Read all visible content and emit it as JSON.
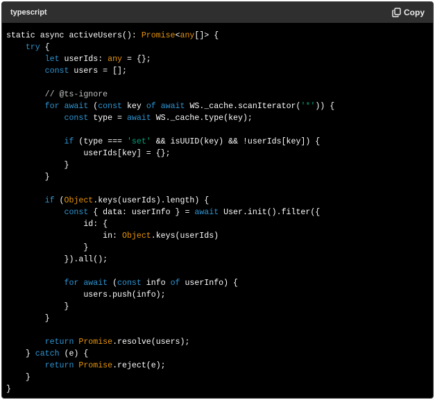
{
  "header": {
    "language": "typescript",
    "copy_label": "Copy",
    "copy_icon": "clipboard-icon"
  },
  "colors": {
    "background": "#000000",
    "header": "#2f2f2f",
    "plain": "#ffffff",
    "keyword": "#2e95d3",
    "builtin": "#e9950c",
    "string": "#00a67d",
    "comment": "#c4c4c4"
  },
  "code_lines": [
    [
      [
        "plain",
        "static async activeUsers(): "
      ],
      [
        "builtin",
        "Promise"
      ],
      [
        "plain",
        "<"
      ],
      [
        "builtin",
        "any"
      ],
      [
        "plain",
        "[]> {"
      ]
    ],
    [
      [
        "plain",
        "    "
      ],
      [
        "kw",
        "try"
      ],
      [
        "plain",
        " {"
      ]
    ],
    [
      [
        "plain",
        "        "
      ],
      [
        "kw",
        "let"
      ],
      [
        "plain",
        " userIds: "
      ],
      [
        "builtin",
        "any"
      ],
      [
        "plain",
        " = {};"
      ]
    ],
    [
      [
        "plain",
        "        "
      ],
      [
        "kw",
        "const"
      ],
      [
        "plain",
        " users = [];"
      ]
    ],
    [
      [
        "plain",
        ""
      ]
    ],
    [
      [
        "plain",
        "        "
      ],
      [
        "cmt",
        "// @ts-ignore"
      ]
    ],
    [
      [
        "plain",
        "        "
      ],
      [
        "kw",
        "for await"
      ],
      [
        "plain",
        " ("
      ],
      [
        "kw",
        "const"
      ],
      [
        "plain",
        " key "
      ],
      [
        "kw",
        "of await"
      ],
      [
        "plain",
        " WS._cache.scanIterator("
      ],
      [
        "str",
        "'*'"
      ],
      [
        "plain",
        ")) {"
      ]
    ],
    [
      [
        "plain",
        "            "
      ],
      [
        "kw",
        "const"
      ],
      [
        "plain",
        " type = "
      ],
      [
        "kw",
        "await"
      ],
      [
        "plain",
        " WS._cache.type(key);"
      ]
    ],
    [
      [
        "plain",
        ""
      ]
    ],
    [
      [
        "plain",
        "            "
      ],
      [
        "kw",
        "if"
      ],
      [
        "plain",
        " (type === "
      ],
      [
        "str",
        "'set'"
      ],
      [
        "plain",
        " && isUUID(key) && !userIds[key]) {"
      ]
    ],
    [
      [
        "plain",
        "                userIds[key] = {};"
      ]
    ],
    [
      [
        "plain",
        "            }"
      ]
    ],
    [
      [
        "plain",
        "        }"
      ]
    ],
    [
      [
        "plain",
        ""
      ]
    ],
    [
      [
        "plain",
        "        "
      ],
      [
        "kw",
        "if"
      ],
      [
        "plain",
        " ("
      ],
      [
        "builtin",
        "Object"
      ],
      [
        "plain",
        ".keys(userIds).length) {"
      ]
    ],
    [
      [
        "plain",
        "            "
      ],
      [
        "kw",
        "const"
      ],
      [
        "plain",
        " { data: userInfo } = "
      ],
      [
        "kw",
        "await"
      ],
      [
        "plain",
        " User.init().filter({"
      ]
    ],
    [
      [
        "plain",
        "                id: {"
      ]
    ],
    [
      [
        "plain",
        "                    in: "
      ],
      [
        "builtin",
        "Object"
      ],
      [
        "plain",
        ".keys(userIds)"
      ]
    ],
    [
      [
        "plain",
        "                }"
      ]
    ],
    [
      [
        "plain",
        "            }).all();"
      ]
    ],
    [
      [
        "plain",
        ""
      ]
    ],
    [
      [
        "plain",
        "            "
      ],
      [
        "kw",
        "for await"
      ],
      [
        "plain",
        " ("
      ],
      [
        "kw",
        "const"
      ],
      [
        "plain",
        " info "
      ],
      [
        "kw",
        "of"
      ],
      [
        "plain",
        " userInfo) {"
      ]
    ],
    [
      [
        "plain",
        "                users.push(info);"
      ]
    ],
    [
      [
        "plain",
        "            }"
      ]
    ],
    [
      [
        "plain",
        "        }"
      ]
    ],
    [
      [
        "plain",
        ""
      ]
    ],
    [
      [
        "plain",
        "        "
      ],
      [
        "kw",
        "return"
      ],
      [
        "plain",
        " "
      ],
      [
        "builtin",
        "Promise"
      ],
      [
        "plain",
        ".resolve(users);"
      ]
    ],
    [
      [
        "plain",
        "    } "
      ],
      [
        "kw",
        "catch"
      ],
      [
        "plain",
        " (e) {"
      ]
    ],
    [
      [
        "plain",
        "        "
      ],
      [
        "kw",
        "return"
      ],
      [
        "plain",
        " "
      ],
      [
        "builtin",
        "Promise"
      ],
      [
        "plain",
        ".reject(e);"
      ]
    ],
    [
      [
        "plain",
        "    }"
      ]
    ],
    [
      [
        "plain",
        "}"
      ]
    ]
  ]
}
